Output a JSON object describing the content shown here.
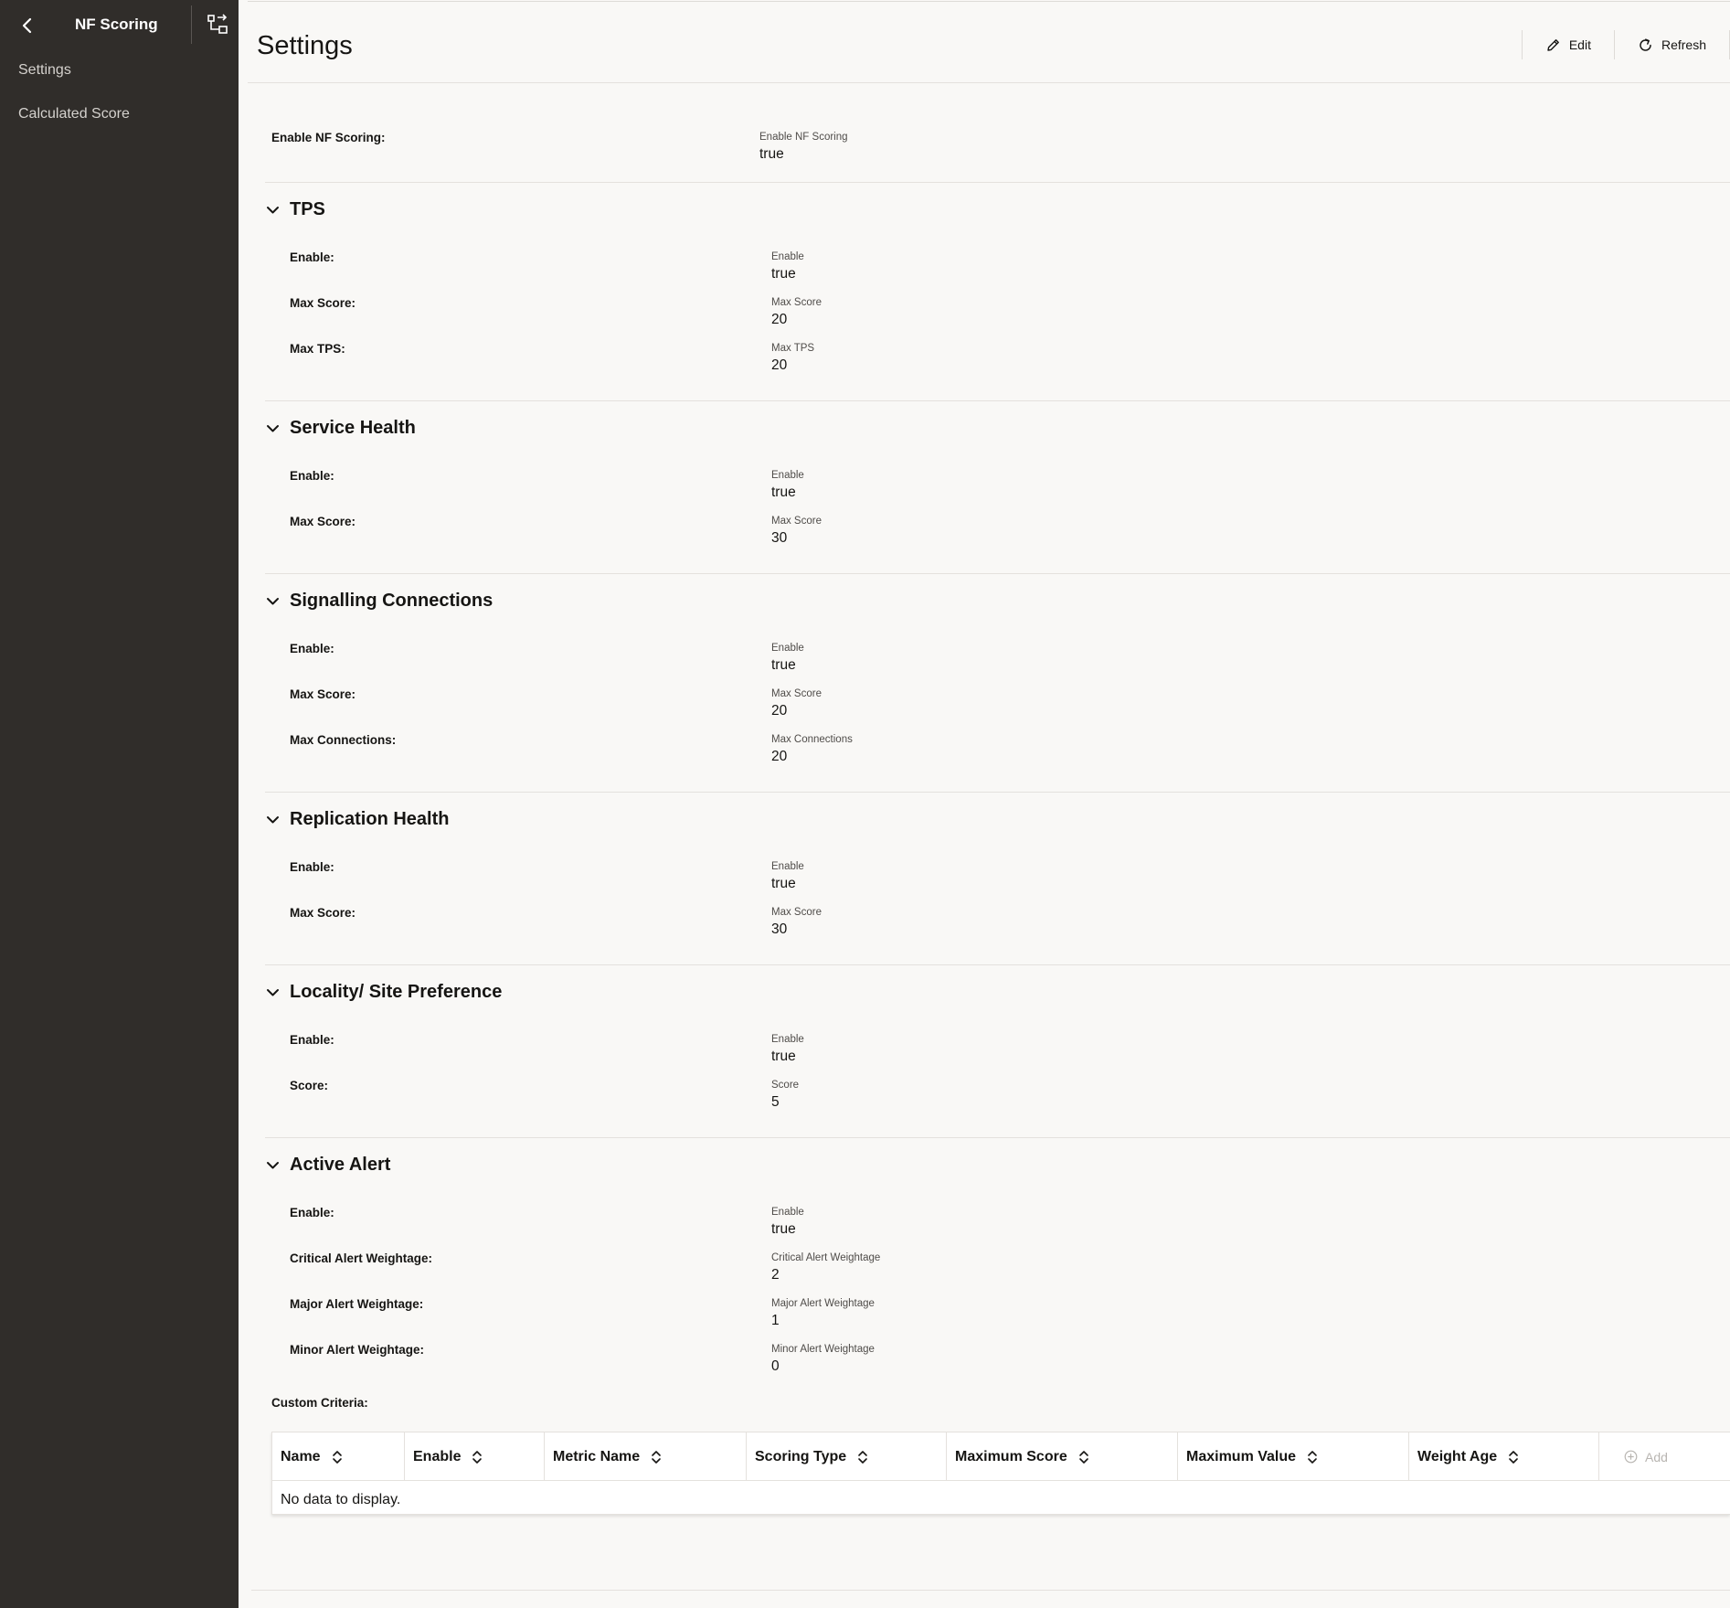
{
  "sidebar": {
    "title": "NF Scoring",
    "items": [
      {
        "label": "Settings"
      },
      {
        "label": "Calculated Score"
      }
    ]
  },
  "header": {
    "title": "Settings",
    "edit_label": "Edit",
    "refresh_label": "Refresh"
  },
  "enable_nf_scoring": {
    "label": "Enable NF Scoring:",
    "caption": "Enable NF Scoring",
    "value": "true"
  },
  "sections": {
    "tps": {
      "title": "TPS",
      "rows": [
        {
          "label": "Enable:",
          "caption": "Enable",
          "value": "true"
        },
        {
          "label": "Max Score:",
          "caption": "Max Score",
          "value": "20"
        },
        {
          "label": "Max TPS:",
          "caption": "Max TPS",
          "value": "20"
        }
      ]
    },
    "service_health": {
      "title": "Service Health",
      "rows": [
        {
          "label": "Enable:",
          "caption": "Enable",
          "value": "true"
        },
        {
          "label": "Max Score:",
          "caption": "Max Score",
          "value": "30"
        }
      ]
    },
    "signalling": {
      "title": "Signalling Connections",
      "rows": [
        {
          "label": "Enable:",
          "caption": "Enable",
          "value": "true"
        },
        {
          "label": "Max Score:",
          "caption": "Max Score",
          "value": "20"
        },
        {
          "label": "Max Connections:",
          "caption": "Max Connections",
          "value": "20"
        }
      ]
    },
    "replication": {
      "title": "Replication Health",
      "rows": [
        {
          "label": "Enable:",
          "caption": "Enable",
          "value": "true"
        },
        {
          "label": "Max Score:",
          "caption": "Max Score",
          "value": "30"
        }
      ]
    },
    "locality": {
      "title": "Locality/ Site Preference",
      "rows": [
        {
          "label": "Enable:",
          "caption": "Enable",
          "value": "true"
        },
        {
          "label": "Score:",
          "caption": "Score",
          "value": "5"
        }
      ]
    },
    "active_alert": {
      "title": "Active Alert",
      "rows": [
        {
          "label": "Enable:",
          "caption": "Enable",
          "value": "true"
        },
        {
          "label": "Critical Alert Weightage:",
          "caption": "Critical Alert Weightage",
          "value": "2"
        },
        {
          "label": "Major Alert Weightage:",
          "caption": "Major Alert Weightage",
          "value": "1"
        },
        {
          "label": "Minor Alert Weightage:",
          "caption": "Minor Alert Weightage",
          "value": "0"
        }
      ]
    }
  },
  "custom_criteria": {
    "label": "Custom Criteria:",
    "columns": [
      "Name",
      "Enable",
      "Metric Name",
      "Scoring Type",
      "Maximum Score",
      "Maximum Value",
      "Weight Age"
    ],
    "add_label": "Add",
    "empty_text": "No data to display."
  },
  "icons": {
    "back": "chevron-left-icon",
    "collapse": "sidebar-collapse-icon",
    "edit": "pencil-icon",
    "refresh": "refresh-icon",
    "section_toggle": "chevron-down-icon",
    "sort": "sort-icon",
    "add": "plus-circle-icon"
  },
  "colors": {
    "sidebar_bg": "#302d2a",
    "page_bg": "#f9f8f6",
    "text": "#161513"
  }
}
